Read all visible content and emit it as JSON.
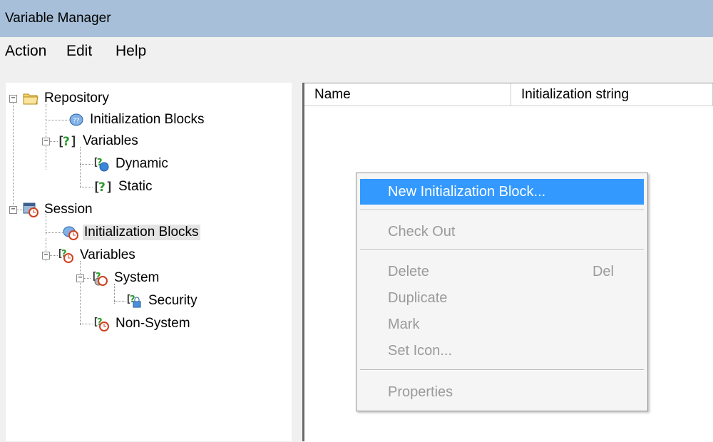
{
  "window": {
    "title": "Variable Manager"
  },
  "menubar": {
    "items": [
      "Action",
      "Edit",
      "Help"
    ]
  },
  "tree": {
    "repository": "Repository",
    "repo_init_blocks": "Initialization Blocks",
    "repo_variables": "Variables",
    "dynamic": "Dynamic",
    "static": "Static",
    "session": "Session",
    "session_init_blocks": "Initialization Blocks",
    "session_variables": "Variables",
    "system": "System",
    "security": "Security",
    "non_system": "Non-System",
    "selected": "session_init_blocks"
  },
  "list": {
    "columns": [
      "Name",
      "Initialization string"
    ]
  },
  "context_menu": {
    "items": [
      {
        "label": "New Initialization Block...",
        "enabled": true,
        "highlighted": true
      },
      {
        "label": "Check Out",
        "enabled": false
      },
      {
        "label": "Delete",
        "shortcut": "Del",
        "enabled": false
      },
      {
        "label": "Duplicate",
        "enabled": false
      },
      {
        "label": "Mark",
        "enabled": false
      },
      {
        "label": "Set Icon...",
        "enabled": false
      },
      {
        "label": "Properties",
        "enabled": false
      }
    ]
  },
  "colors": {
    "titlebar": "#a7bfd9",
    "highlight": "#3399ff",
    "disabled_text": "#9a9a9a"
  },
  "icons": {
    "repository": "folder-icon",
    "init_block": "database-icon",
    "variables": "variable-icon",
    "dynamic": "dynamic-variable-icon",
    "session": "session-icon",
    "system": "system-variable-icon",
    "security": "security-variable-icon"
  }
}
